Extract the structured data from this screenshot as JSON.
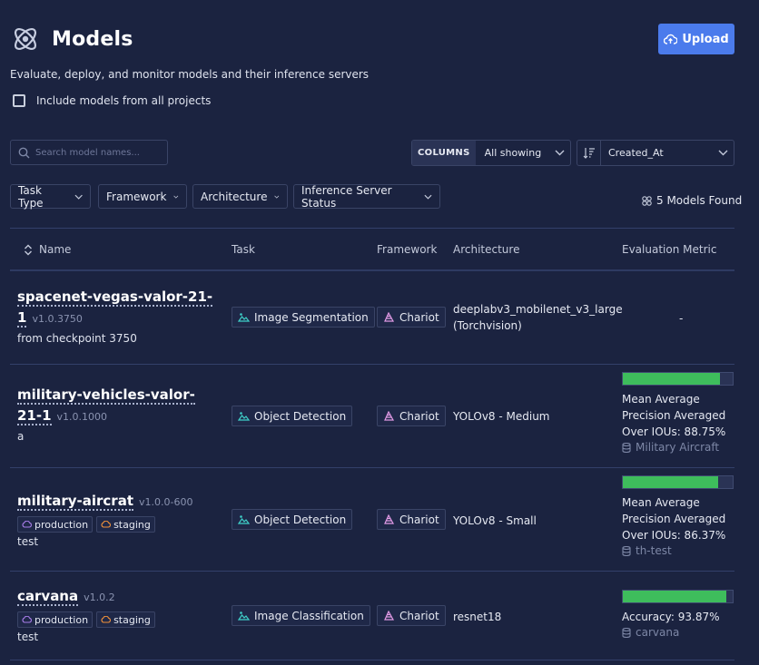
{
  "header": {
    "title": "Models",
    "subtitle": "Evaluate, deploy, and monitor models and their inference servers",
    "upload_label": "Upload",
    "include_all_label": "Include models from all projects",
    "include_all_checked": false
  },
  "toolbar": {
    "search_placeholder": "Search model names...",
    "columns_label": "COLUMNS",
    "columns_value": "All showing",
    "sort_value": "Created_At"
  },
  "filters": [
    "Task Type",
    "Framework",
    "Architecture",
    "Inference Server Status"
  ],
  "found_label": "5 Models Found",
  "table": {
    "headers": {
      "name": "Name",
      "task": "Task",
      "framework": "Framework",
      "architecture": "Architecture",
      "metric": "Evaluation Metric"
    },
    "rows": [
      {
        "name_line1": "spacenet-vegas-valor-21-",
        "name_line2": "1",
        "version": "v1.0.3750",
        "description": "from checkpoint 3750",
        "task": "Image Segmentation",
        "framework": "Chariot",
        "architecture_line1": "deeplabv3_mobilenet_v3_large",
        "architecture_line2": "(Torchvision)",
        "metric_empty": "-"
      },
      {
        "name_line1": "military-vehicles-valor-",
        "name_line2": "21-1",
        "version": "v1.0.1000",
        "description": "a",
        "task": "Object Detection",
        "framework": "Chariot",
        "architecture_line1": "YOLOv8 - Medium",
        "metric_fraction": 0.8875,
        "metric_line1": "Mean Average",
        "metric_line2": "Precision Averaged",
        "metric_line3": "Over IOUs: 88.75%",
        "dataset": "Military Aircraft"
      },
      {
        "name_line1": "military-aircrat",
        "version": "v1.0.0-600",
        "tags": [
          "production",
          "staging"
        ],
        "description": "test",
        "task": "Object Detection",
        "framework": "Chariot",
        "architecture_line1": "YOLOv8 - Small",
        "metric_fraction": 0.8637,
        "metric_line1": "Mean Average",
        "metric_line2": "Precision Averaged",
        "metric_line3": "Over IOUs: 86.37%",
        "dataset": "th-test"
      },
      {
        "name_line1": "carvana",
        "version": "v1.0.2",
        "tags": [
          "production",
          "staging"
        ],
        "description": "test",
        "task": "Image Classification",
        "framework": "Chariot",
        "architecture_line1": "resnet18",
        "metric_fraction": 0.9387,
        "metric_line1": "Accuracy: 93.87%",
        "dataset": "carvana"
      }
    ]
  },
  "colors": {
    "background": "#1b2340",
    "accent": "#4b7bec",
    "metric_bar": "#3ebd5c",
    "task_icon": "#3fd0c9",
    "framework_icon": "#e29be6",
    "production_icon": "#a77ce8",
    "staging_icon": "#f0913a"
  },
  "icons": {
    "logo": "atom-icon",
    "upload": "cloud-upload-icon",
    "search": "search-icon",
    "sort": "sort-icon",
    "found": "models-icon",
    "task": "image-icon",
    "framework": "chariot-icon",
    "dataset": "database-icon"
  }
}
